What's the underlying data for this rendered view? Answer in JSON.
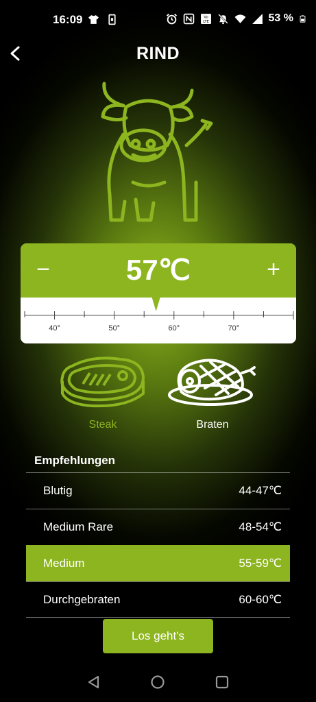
{
  "status_bar": {
    "time": "16:09",
    "battery_percent": "53 %",
    "icons_left": [
      "tshirt-icon",
      "phone-card-icon"
    ],
    "icons_right": [
      "alarm-icon",
      "nfc-icon",
      "volte-icon",
      "mute-icon",
      "wifi-icon",
      "signal-icon",
      "battery-icon"
    ]
  },
  "header": {
    "title": "RIND",
    "back_icon": "chevron-left-icon"
  },
  "temperature": {
    "value": "57℃",
    "minus_label": "−",
    "plus_label": "+",
    "scale_labels": [
      "40°",
      "50°",
      "60°",
      "70°"
    ],
    "scale_min": 35,
    "scale_max": 80,
    "pointer_value": 57
  },
  "cut_options": [
    {
      "label": "Steak",
      "selected": true
    },
    {
      "label": "Braten",
      "selected": false
    }
  ],
  "recommendations": {
    "title": "Empfehlungen",
    "items": [
      {
        "name": "Blutig",
        "range": "44-47℃"
      },
      {
        "name": "Medium Rare",
        "range": "48-54℃"
      },
      {
        "name": "Medium",
        "range": "55-59℃"
      },
      {
        "name": "Durchgebraten",
        "range": "60-60℃"
      }
    ],
    "active_index": 2
  },
  "go_button": {
    "label": "Los geht's"
  },
  "nav_bar": {
    "icons": [
      "back-triangle-icon",
      "home-circle-icon",
      "recents-square-icon"
    ]
  },
  "colors": {
    "accent": "#8cb51f",
    "background": "#000000",
    "text": "#ffffff"
  }
}
